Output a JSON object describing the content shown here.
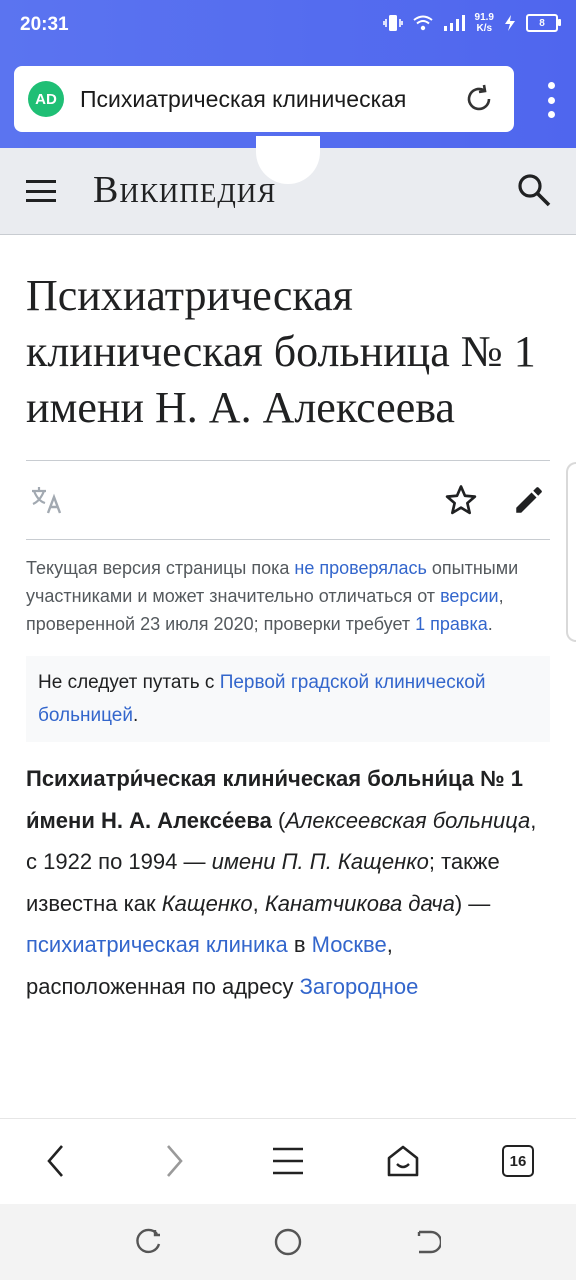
{
  "status": {
    "time": "20:31",
    "speed_value": "91.9",
    "speed_unit": "K/s",
    "battery": "8"
  },
  "browser": {
    "ad_logo": "AD",
    "url_text": "Психиатрическая клиническая",
    "icons": [
      "reload-icon",
      "kebab-menu-icon"
    ]
  },
  "wiki_header": {
    "logo": "Википедия",
    "icons": [
      "hamburger-menu-icon",
      "search-icon"
    ]
  },
  "article": {
    "title": "Психиатрическая клиническая больница № 1 имени Н. А. Алексеева",
    "actions": [
      "translate-icon",
      "star-icon",
      "edit-icon"
    ],
    "notice": {
      "p1": "Текущая версия страницы пока ",
      "link1": "не проверялась",
      "p2": " опытными участниками и может значительно отличаться от ",
      "link2": "версии",
      "p3": ", проверенной 23 июля 2020; проверки требует ",
      "link3": "1 правка",
      "p4": "."
    },
    "hatnote": {
      "text": "Не следует путать с ",
      "link": "Первой градской клинической больницей",
      "end": "."
    },
    "lead": {
      "bold": "Психиатри́ческая клини́ческая больни́ца № 1 и́мени Н. А. Алексе́ева",
      "s1": " (",
      "i1": "Алексеевская больница",
      "s2": ", с 1922 по 1994 — ",
      "i2": "имени П. П. Кащенко",
      "s3": "; также известна как ",
      "i3": "Кащенко",
      "s4": ", ",
      "i4": "Канатчикова дача",
      "s5": ") — ",
      "link1": "психиатрическая клиника",
      "s6": " в ",
      "link2": "Москве",
      "s7": ", расположенная по адресу ",
      "link3": "Загородное"
    }
  },
  "toolbar": {
    "tabs_count": "16",
    "icons": [
      "back-icon",
      "forward-icon",
      "menu-icon",
      "home-icon",
      "tabs-icon"
    ]
  },
  "navbar": {
    "icons": [
      "recent-apps-icon",
      "home-circle-icon",
      "back-nav-icon"
    ]
  },
  "colors": {
    "accent": "#5b74f0",
    "link": "#3366cc",
    "ad_logo": "#1fbf75"
  }
}
